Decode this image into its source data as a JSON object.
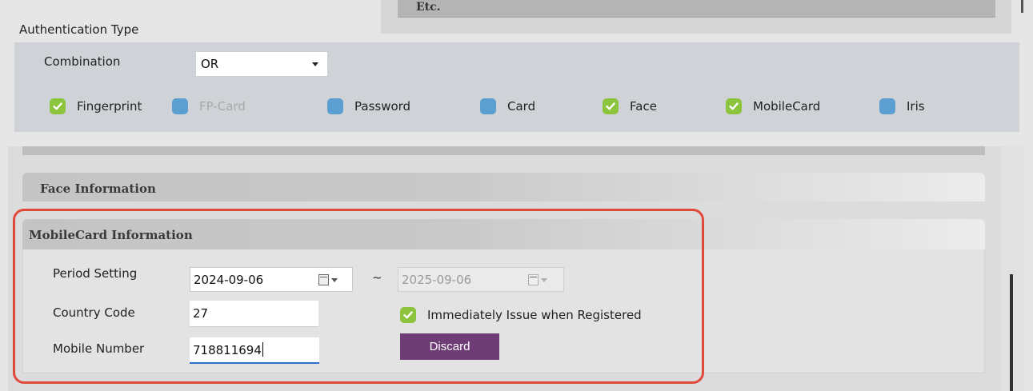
{
  "top": {
    "etc_label": "Etc."
  },
  "auth": {
    "title": "Authentication Type",
    "combination_label": "Combination",
    "combination_value": "OR",
    "methods": [
      {
        "label": "Fingerprint",
        "checked": true,
        "enabled": true
      },
      {
        "label": "FP-Card",
        "checked": false,
        "enabled": false
      },
      {
        "label": "Password",
        "checked": false,
        "enabled": true
      },
      {
        "label": "Card",
        "checked": false,
        "enabled": true
      },
      {
        "label": "Face",
        "checked": true,
        "enabled": true
      },
      {
        "label": "MobileCard",
        "checked": true,
        "enabled": true
      },
      {
        "label": "Iris",
        "checked": false,
        "enabled": true
      }
    ]
  },
  "face": {
    "title": "Face Information"
  },
  "mobilecard": {
    "title": "MobileCard Information",
    "period_label": "Period Setting",
    "period_start": "2024-09-06",
    "period_separator": "~",
    "period_end": "2025-09-06",
    "country_code_label": "Country Code",
    "country_code_value": "27",
    "mobile_number_label": "Mobile Number",
    "mobile_number_value": "718811694",
    "issue_label": "Immediately Issue when Registered",
    "issue_checked": true,
    "discard_label": "Discard"
  },
  "colors": {
    "checkbox_on": "#8cc43d",
    "checkbox_off": "#5b9fd1",
    "discard_button": "#6e3d76",
    "highlight_border": "#e04a3a",
    "input_focus": "#2b6fc9"
  }
}
